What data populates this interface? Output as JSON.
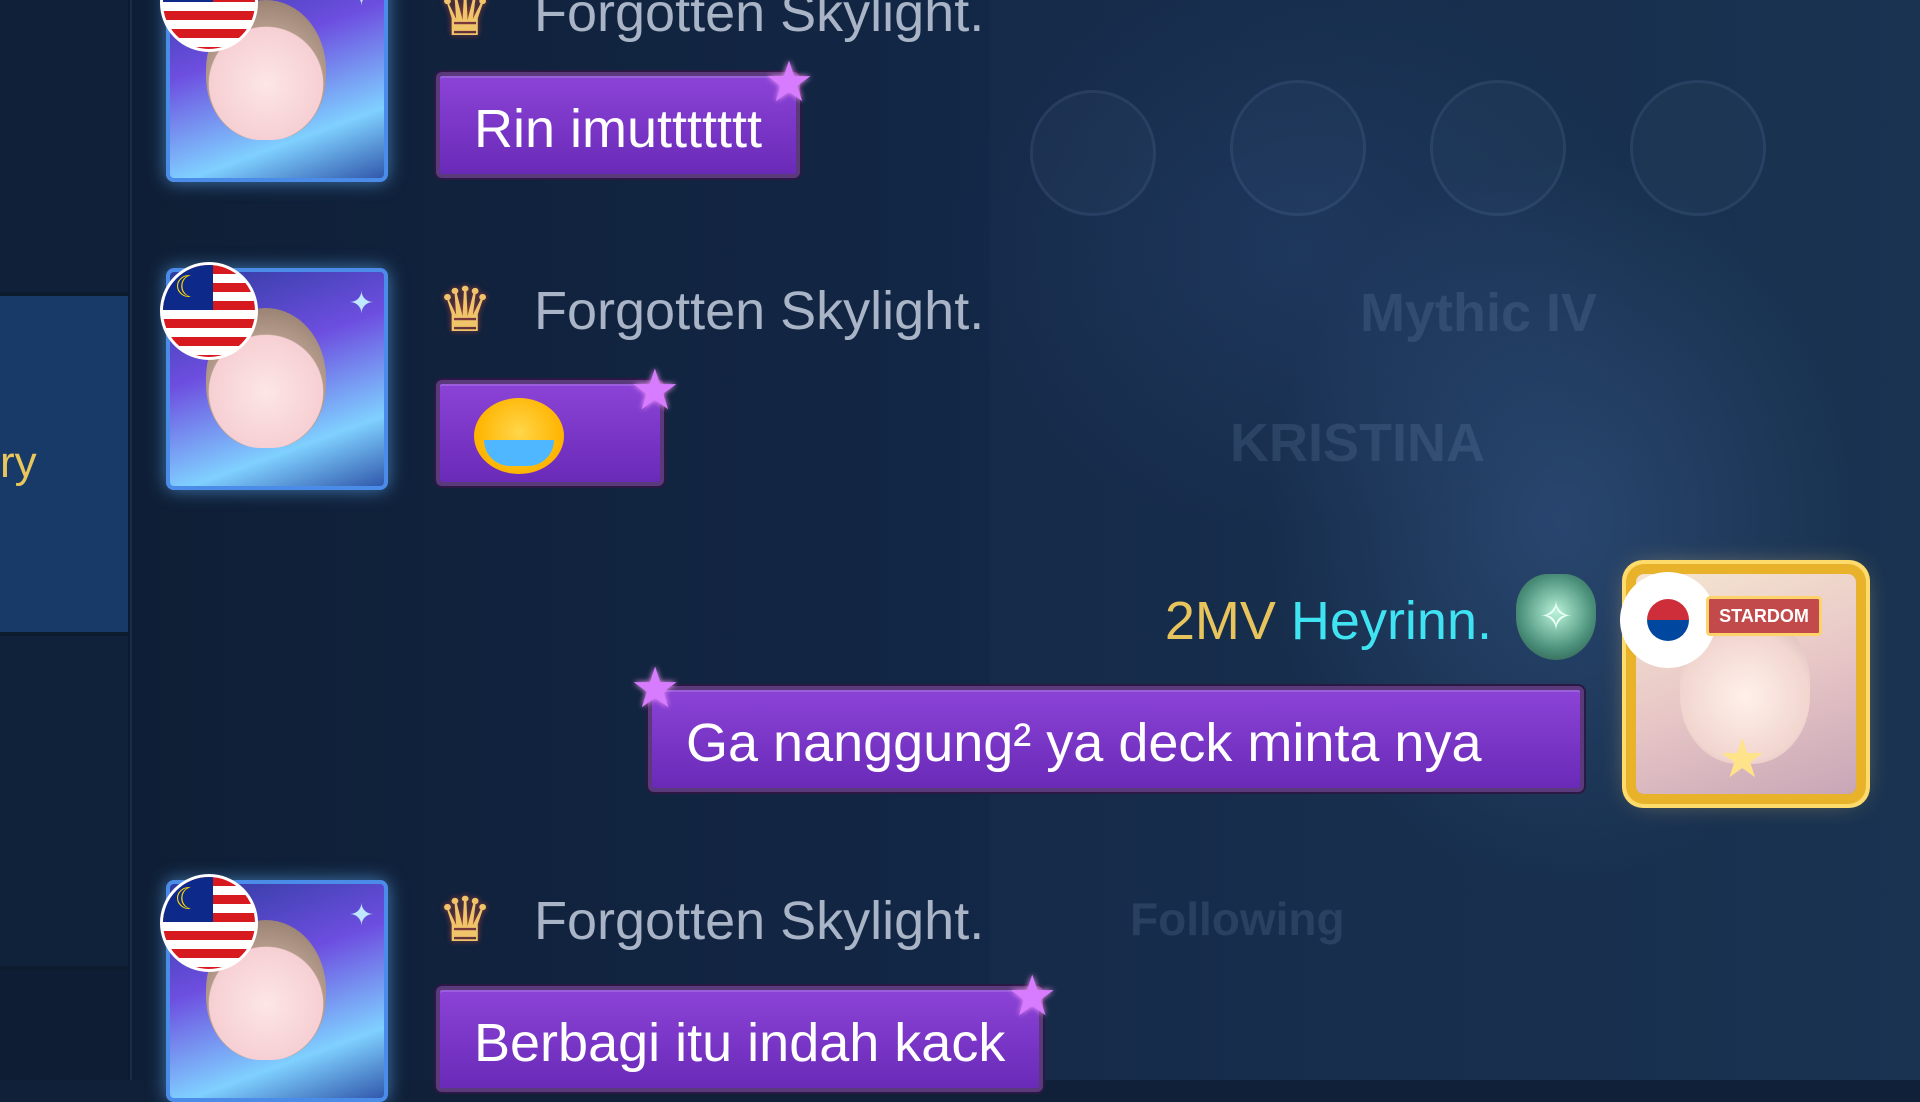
{
  "sidebar": {
    "visible_label": "ry"
  },
  "background": {
    "faded_texts": [
      "Mythic IV",
      "KRISTINA",
      "Following"
    ]
  },
  "messages": [
    {
      "sender": "Forgotten Skylight.",
      "text": "Rin imuttttttt"
    },
    {
      "sender": "Forgotten Skylight.",
      "emoji": "crying-face"
    },
    {
      "sender_tag": "2MV",
      "sender": "Heyrinn.",
      "text": "Ga nanggung² ya deck minta nya"
    },
    {
      "sender": "Forgotten Skylight.",
      "text": "Berbagi itu indah kack"
    }
  ],
  "my_avatar": {
    "badge": "STARDOM"
  },
  "colors": {
    "bubble": "#7b38c8",
    "sender_name": "#a9b4c6",
    "tag": "#e8c45c",
    "self_name": "#3fe3f2"
  }
}
